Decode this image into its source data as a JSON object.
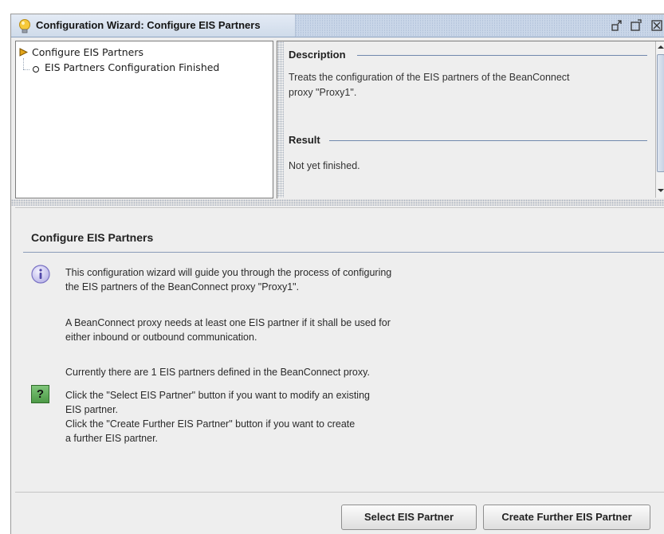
{
  "window": {
    "title": "Configuration Wizard: Configure EIS Partners",
    "icon": "lightbulb-icon",
    "controls": [
      "restore-icon",
      "maximize-icon",
      "close-icon"
    ]
  },
  "tree": {
    "items": [
      {
        "label": "Configure EIS Partners",
        "marker": "arrow-right-icon"
      },
      {
        "label": "EIS Partners Configuration Finished",
        "marker": "circle-icon"
      }
    ]
  },
  "details": {
    "description_heading": "Description",
    "description_line1": "Treats the configuration of the EIS partners of the BeanConnect",
    "description_line2": "proxy \"Proxy1\".",
    "result_heading": "Result",
    "result_text": "Not yet finished."
  },
  "main": {
    "title": "Configure EIS Partners",
    "info_icon": "info-icon",
    "question_icon": "question-icon",
    "question_symbol": "?",
    "lines": [
      "This configuration wizard will guide you through the process of configuring",
      "the EIS partners of the BeanConnect proxy \"Proxy1\".",
      "A BeanConnect proxy needs at least one EIS partner if it shall be used for",
      "either inbound or outbound communication.",
      "Currently there are 1 EIS partners defined in the BeanConnect proxy.",
      "Click the \"Select EIS Partner\" button if you want to modify an existing",
      "EIS partner.",
      "Click the \"Create Further EIS Partner\" button if you want to create",
      "a further EIS partner."
    ]
  },
  "buttons": {
    "select": "Select EIS Partner",
    "create": "Create Further EIS Partner"
  },
  "colors": {
    "accent_rule": "#7088ad",
    "titlebar": "#c9d6e8",
    "question_green": "#5aa854",
    "info_purple": "#8c86c9"
  }
}
